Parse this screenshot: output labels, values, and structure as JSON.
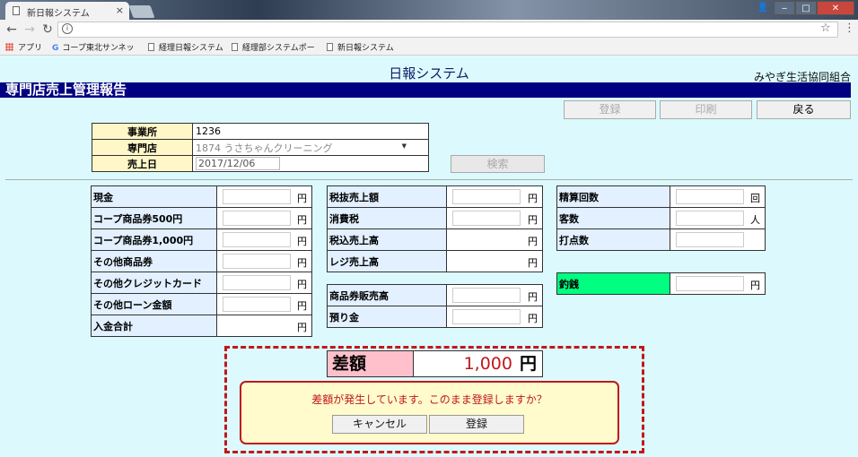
{
  "browser": {
    "tab_title": "新日報システム",
    "bookmarks": [
      "アプリ",
      "コープ東北サンネッ",
      "経理日報システム",
      "経理部システムポー",
      "新日報システム"
    ]
  },
  "header": {
    "system_title": "日報システム",
    "org_name": "みやぎ生活協同組合",
    "section_title": "専門店売上管理報告"
  },
  "toolbar": {
    "register": "登録",
    "print": "印刷",
    "back": "戻る"
  },
  "office": {
    "office_label": "事業所",
    "office_value": "1236",
    "store_label": "専門店",
    "store_value": "1874 うさちゃんクリーニング",
    "date_label": "売上日",
    "date_value": "2017/12/06",
    "search_button": "検索"
  },
  "payments": [
    {
      "label": "現金",
      "unit": "円"
    },
    {
      "label": "コープ商品券500円",
      "unit": "円"
    },
    {
      "label": "コープ商品券1,000円",
      "unit": "円"
    },
    {
      "label": "その他商品券",
      "unit": "円"
    },
    {
      "label": "その他クレジットカード",
      "unit": "円"
    },
    {
      "label": "その他ローン金額",
      "unit": "円"
    },
    {
      "label": "入金合計",
      "unit": "円"
    }
  ],
  "sales": [
    {
      "label": "税抜売上額",
      "unit": "円"
    },
    {
      "label": "消費税",
      "unit": "円"
    },
    {
      "label": "税込売上高",
      "unit": "円"
    },
    {
      "label": "レジ売上高",
      "unit": "円"
    }
  ],
  "vouchers": [
    {
      "label": "商品券販売高",
      "unit": "円"
    },
    {
      "label": "預り金",
      "unit": "円"
    }
  ],
  "counts": [
    {
      "label": "精算回数",
      "unit": "回"
    },
    {
      "label": "客数",
      "unit": "人"
    },
    {
      "label": "打点数",
      "unit": ""
    }
  ],
  "change": {
    "label": "釣銭",
    "unit": "円"
  },
  "difference": {
    "label": "差額",
    "amount": "1,000",
    "unit": "円",
    "message": "差額が発生しています。このまま登録しますか？",
    "cancel": "キャンセル",
    "confirm": "登録"
  },
  "colors": {
    "nav_bar": "#000080",
    "page_bg": "#dcfafd",
    "alert": "#c0181c",
    "change_label": "#00ff80"
  }
}
